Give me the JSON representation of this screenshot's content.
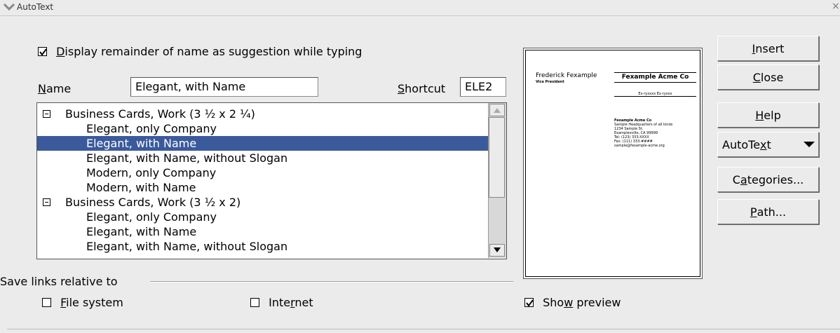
{
  "window": {
    "title": "AutoText"
  },
  "options": {
    "suggestion_label_pre": "",
    "suggestion_label_mn": "D",
    "suggestion_label_post": "isplay remainder of name as suggestion while typing",
    "suggestion_checked": true
  },
  "name_field": {
    "label_mn": "N",
    "label_rest": "ame",
    "value": "Elegant, with Name"
  },
  "shortcut_field": {
    "label_mn": "S",
    "label_rest": "hortcut",
    "value": "ELE2"
  },
  "tree": {
    "groups": [
      {
        "label": "Business Cards, Work (3 ½ x 2 ¼)",
        "items": [
          "Elegant, only Company",
          "Elegant, with Name",
          "Elegant, with Name, without Slogan",
          "Modern, only Company",
          "Modern, with Name"
        ]
      },
      {
        "label": "Business Cards, Work (3 ½ x 2)",
        "items": [
          "Elegant, only Company",
          "Elegant, with Name",
          "Elegant, with Name, without Slogan"
        ]
      }
    ],
    "selected": "Elegant, with Name"
  },
  "preview": {
    "person_name": "Frederick Fexample",
    "person_title": "Vice President",
    "company": "Fexample Acme Co",
    "slogan": "Ex-ryxxxx Ex-ryxxx",
    "address": [
      "Fexample Acme Co",
      "Sample Headquarters of all kinds",
      "1234 Sample St.",
      "Examplesville, CA 99999",
      "Tel: (123) 333-XXXX",
      "Fax: (111) 333-####",
      "sample@fexample-acme.org"
    ],
    "show_preview_pre": "Sho",
    "show_preview_mn": "w",
    "show_preview_post": " preview",
    "show_preview_checked": true
  },
  "save_links": {
    "label": "Save links relative to",
    "file_system_mn": "F",
    "file_system_rest": "ile system",
    "file_system_checked": false,
    "internet_pre": "Inte",
    "internet_mn": "r",
    "internet_post": "net",
    "internet_checked": false
  },
  "buttons": {
    "insert_mn": "I",
    "insert_rest": "nsert",
    "close_mn": "C",
    "close_rest": "lose",
    "help_mn": "H",
    "help_rest": "elp",
    "autotext_pre": "AutoTe",
    "autotext_mn": "x",
    "autotext_post": "t",
    "categories_pre": "C",
    "categories_mn": "a",
    "categories_post": "tegories...",
    "path_mn": "P",
    "path_rest": "ath..."
  },
  "icons": {
    "window_menu": "chevron-down-icon",
    "expander": "minus-box-icon",
    "checkbox_checked": "checkmark-icon",
    "scroll_up": "triangle-up-icon",
    "scroll_down": "triangle-down-icon",
    "menu_arrow": "triangle-down-icon"
  },
  "colors": {
    "selection": "#3b5a9c",
    "background": "#ebebeb"
  }
}
